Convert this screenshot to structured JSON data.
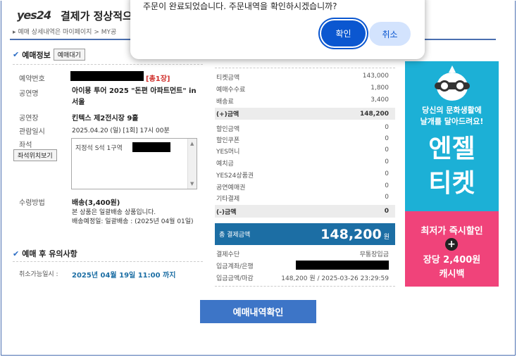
{
  "header": {
    "logo": "yes24",
    "title": "결제가 정상적으",
    "breadcrumb": "▸ 예매 상세내역은 마이페이지 > MY공"
  },
  "reservation": {
    "section_title": "예매정보",
    "waiting_button": "예매대기",
    "rows": {
      "booking_no_label": "예약번호",
      "booking_total": "[총1장]",
      "show_label": "공연명",
      "show_value": "아이묭 투어 2025 \"돈편 아파트먼트\" in 서울",
      "venue_label": "공연장",
      "venue_value": "킨텍스 제2전시장 9홀",
      "date_label": "관람일시",
      "date_value": "2025.04.20 (일) [1회] 17시 00분",
      "seat_label": "좌석",
      "seat_button": "좌석위치보기",
      "seat_value": "지정석 S석 1구역",
      "pickup_label": "수령방법",
      "pickup_value": "배송(3,400원)",
      "pickup_note1": "본 상품은 일괄배송 상품입니다.",
      "pickup_note2": "배송예정일: 일괄배송 : (2025년 04월 01일)"
    }
  },
  "notice": {
    "section_title": "예매 후 유의사항",
    "cancel_label": "취소가능일시 :",
    "cancel_value": "2025년 04월 19일 11:00 까지"
  },
  "summary": {
    "rows": [
      {
        "label": "티켓금액",
        "value": "143,000"
      },
      {
        "label": "예매수수료",
        "value": "1,800"
      },
      {
        "label": "배송료",
        "value": "3,400"
      },
      {
        "label": "(+)금액",
        "value": "148,200"
      },
      {
        "label": "할인금액",
        "value": "0"
      },
      {
        "label": "할인쿠폰",
        "value": "0"
      },
      {
        "label": "YES머니",
        "value": "0"
      },
      {
        "label": "예치금",
        "value": "0"
      },
      {
        "label": "YES24상품권",
        "value": "0"
      },
      {
        "label": "공연예매권",
        "value": "0"
      },
      {
        "label": "기타결제",
        "value": "0"
      },
      {
        "label": "(-)금액",
        "value": "0"
      }
    ],
    "total_label": "총 결제금액",
    "total_value": "148,200",
    "total_unit": "원",
    "pay_method_label": "결제수단",
    "pay_method_value": "무통장입금",
    "account_label": "입금계좌/은행",
    "deadline_label": "입금금액/마감",
    "deadline_value": "148,200 원 / 2025-03-26 23:29:59"
  },
  "ad": {
    "line1": "당신의 문화생활에",
    "line2": "날개를 달아드려요!",
    "brand1": "엔젤",
    "brand2": "티켓",
    "promo1": "최저가 즉시할인",
    "plus": "+",
    "promo2": "장당 2,400원",
    "promo3": "캐시백"
  },
  "main_button": "예매내역확인",
  "dialog": {
    "message": "주문이 완료되었습니다. 주문내역을 확인하시겠습니까?",
    "ok": "확인",
    "cancel": "취소"
  }
}
